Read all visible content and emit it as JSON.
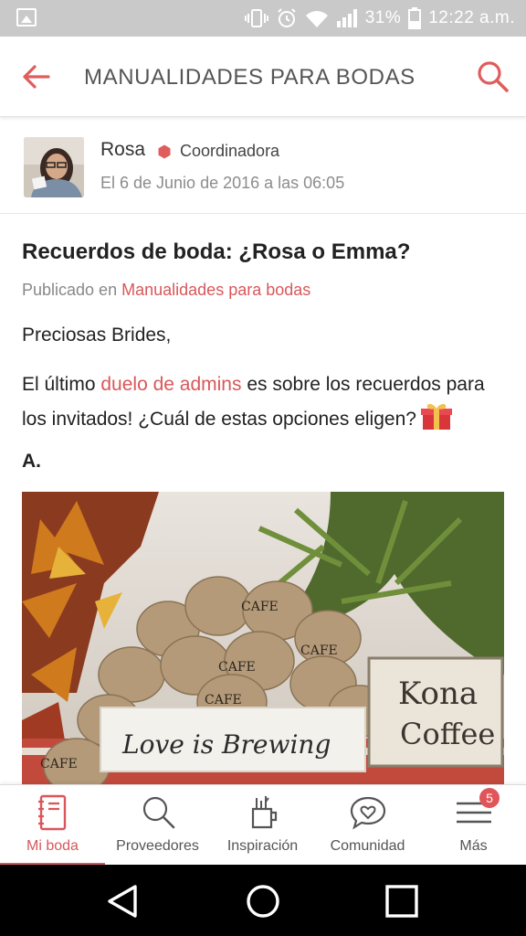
{
  "status_bar": {
    "battery": "31%",
    "time": "12:22 a.m."
  },
  "header": {
    "title": "MANUALIDADES PARA BODAS"
  },
  "author": {
    "name": "Rosa",
    "role": "Coordinadora",
    "date": "El 6 de Junio de 2016 a las 06:05"
  },
  "post": {
    "title": "Recuerdos de boda: ¿Rosa o Emma?",
    "published_prefix": "Publicado en",
    "published_category": "Manualidades para bodas",
    "greeting": "Preciosas Brides,",
    "body_before_link": "El último",
    "body_link": "duelo de admins",
    "body_after_link": "es sobre los recuerdos para los invitados! ¿Cuál de estas opciones eligen?",
    "option_label": "A.",
    "photo": {
      "sign_left": "Love is Brewing",
      "sign_right_1": "Kona",
      "sign_right_2": "Coffee",
      "sack_text": "CAFE"
    }
  },
  "bottom_nav": {
    "items": [
      {
        "label": "Mi boda",
        "icon": "notebook-icon",
        "active": true
      },
      {
        "label": "Proveedores",
        "icon": "search-icon"
      },
      {
        "label": "Inspiración",
        "icon": "inspiration-icon"
      },
      {
        "label": "Comunidad",
        "icon": "chat-heart-icon"
      },
      {
        "label": "Más",
        "icon": "menu-icon",
        "badge": "5"
      }
    ]
  },
  "colors": {
    "accent": "#d9575a",
    "status_bar": "#c9c9c9",
    "text": "#222222"
  }
}
